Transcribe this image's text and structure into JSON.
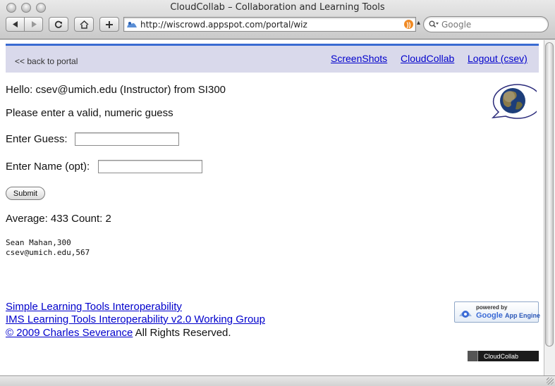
{
  "window": {
    "title": "CloudCollab – Collaboration and Learning Tools"
  },
  "toolbar": {
    "url": "http://wiscrowd.appspot.com/portal/wiz",
    "search_placeholder": "Google",
    "icons": [
      "back-arrow-icon",
      "forward-arrow-icon",
      "reload-icon",
      "home-icon",
      "add-bookmark-icon",
      "rss-icon",
      "search-icon"
    ]
  },
  "page": {
    "back_link": "<< back to portal",
    "nav": [
      {
        "label": "ScreenShots"
      },
      {
        "label": "CloudCollab"
      },
      {
        "label": "Logout (csev)"
      }
    ],
    "hello": "Hello: csev@umich.edu (Instructor) from SI300",
    "message": "Please enter a valid, numeric guess",
    "guess_label": "Enter Guess:",
    "name_label": "Enter Name (opt):",
    "guess_value": "",
    "name_value": "",
    "submit_label": "Submit",
    "stats": "Average: 433 Count: 2",
    "results": [
      "Sean Mahan,300",
      "csev@umich.edu,567"
    ],
    "footer": {
      "link1": "Simple Learning Tools Interoperability",
      "link2": "IMS Learning Tools Interoperability v2.0 Working Group",
      "copyright_link": "© 2009 Charles Severance",
      "copyright_rest": " All Rights Reserved."
    },
    "gae_badge": {
      "line1": "powered by",
      "google": "Google",
      "app_engine": "App Engine"
    },
    "cc_badge": "CloudCollab"
  },
  "colors": {
    "link": "#0000cc",
    "topbar_bg": "#d9d9eb",
    "topbar_accent": "#3a6bd2"
  }
}
